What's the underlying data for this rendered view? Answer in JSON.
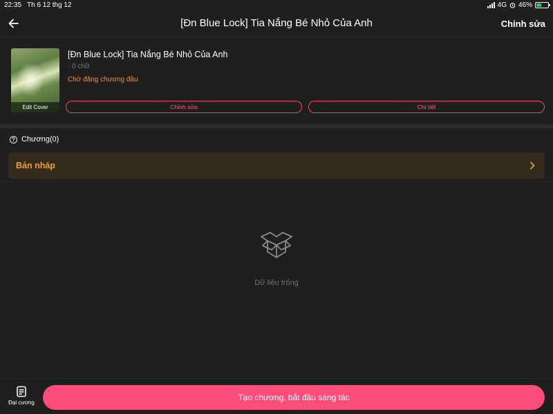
{
  "status_bar": {
    "time": "22:35",
    "date": "Th 6 12 thg 12",
    "network": "4G",
    "battery_percent": "46%",
    "battery_level": 0.46,
    "battery_color": "#34c759",
    "icons": [
      "signal-icon",
      "alarm-icon",
      "battery-icon"
    ]
  },
  "nav": {
    "back_icon": "arrow-left-icon",
    "title": "[Đn Blue Lock] Tia Nắng Bé Nhỏ Của Anh",
    "edit_label": "Chỉnh sửa"
  },
  "book": {
    "title": "[Đn Blue Lock] Tia Nắng Bé Nhỏ Của Anh",
    "word_count": "· 0 chữ",
    "status": "Chờ đăng chương đầu",
    "cover_edit_label": "Edit Cover",
    "edit_button": "Chỉnh sửa",
    "detail_button": "Chi tiết"
  },
  "chapters": {
    "header_icon": "help-circle-icon",
    "label": "Chương(0)",
    "drafts_label": "Bản nháp",
    "drafts_icon": "chevron-right-icon"
  },
  "empty_state": {
    "icon": "empty-box-icon",
    "text": "Dữ liệu trống"
  },
  "bottom_bar": {
    "outline_icon": "outline-document-icon",
    "outline_label": "Đại cương",
    "create_button": "Tạo chương, bắt đầu sáng tác"
  },
  "colors": {
    "background": "#1f1f1f",
    "accent_pink": "#ff4d7a",
    "status_orange": "#f0903a",
    "drafts_bg": "#352b1d",
    "drafts_text": "#f0a030"
  }
}
